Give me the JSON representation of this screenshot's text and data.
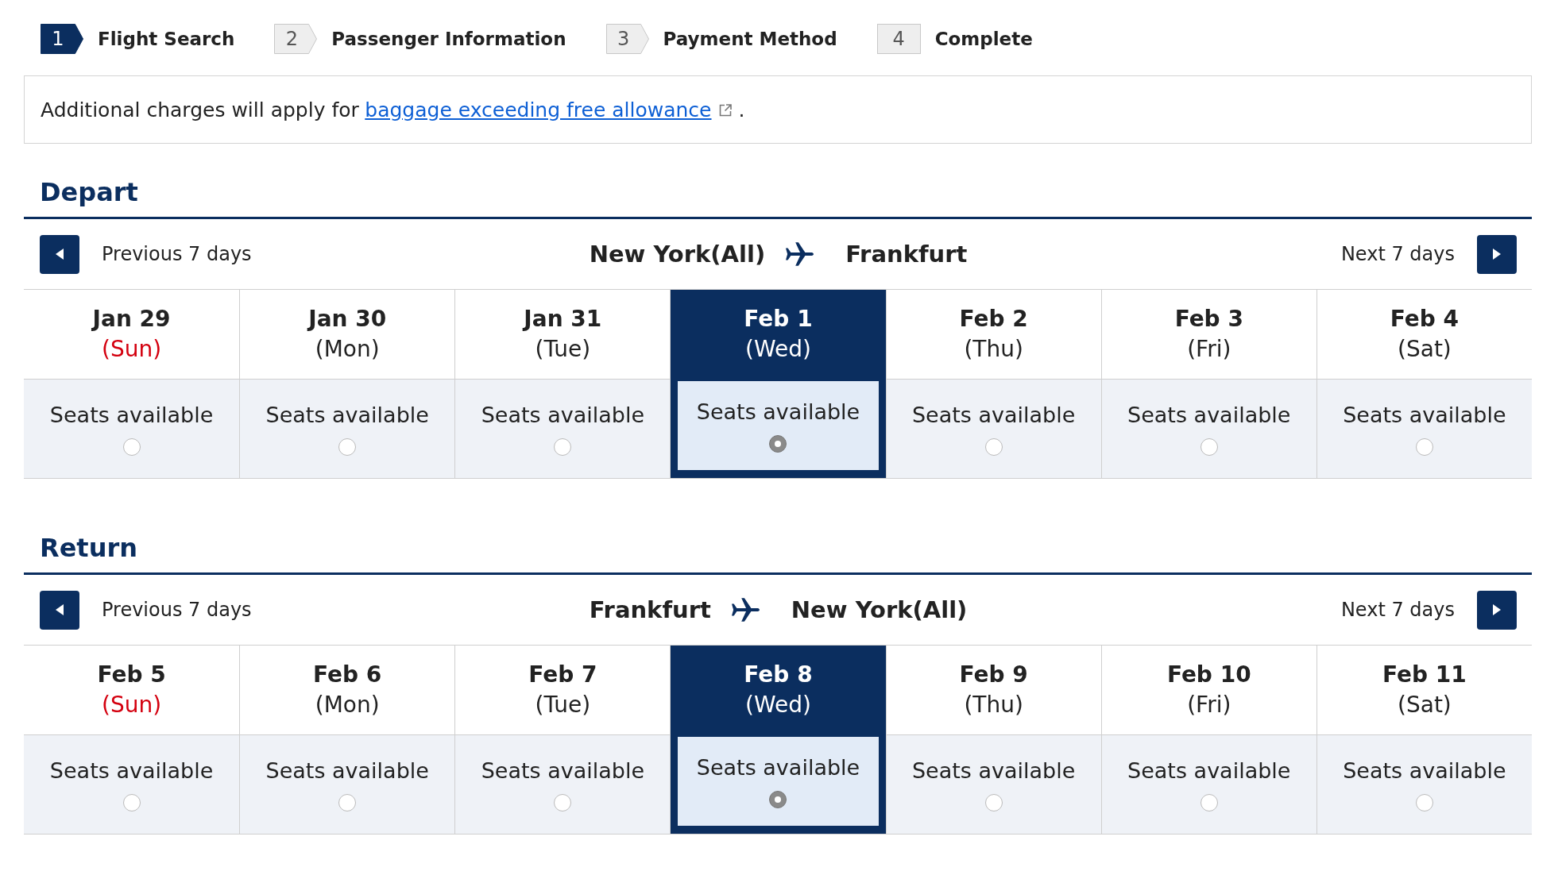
{
  "steps": [
    {
      "number": "1",
      "label": "Flight Search",
      "selected": true
    },
    {
      "number": "2",
      "label": "Passenger Information",
      "selected": false
    },
    {
      "number": "3",
      "label": "Payment Method",
      "selected": false
    },
    {
      "number": "4",
      "label": "Complete",
      "selected": false
    }
  ],
  "notice": {
    "text": "Additional charges will apply for",
    "link": "baggage exceeding free allowance",
    "suffix": "."
  },
  "legs": [
    {
      "title": "Depart",
      "previous_label": "Previous 7 days",
      "origin": "New York(All)",
      "destination": "Frankfurt",
      "next_label": "Next 7 days",
      "days": [
        {
          "date": "Jan 29",
          "weekday": "(Sun)",
          "holiday": true,
          "availability": "Seats available",
          "selected": false
        },
        {
          "date": "Jan 30",
          "weekday": "(Mon)",
          "holiday": false,
          "availability": "Seats available",
          "selected": false
        },
        {
          "date": "Jan 31",
          "weekday": "(Tue)",
          "holiday": false,
          "availability": "Seats available",
          "selected": false
        },
        {
          "date": "Feb 1",
          "weekday": "(Wed)",
          "holiday": false,
          "availability": "Seats available",
          "selected": true
        },
        {
          "date": "Feb 2",
          "weekday": "(Thu)",
          "holiday": false,
          "availability": "Seats available",
          "selected": false
        },
        {
          "date": "Feb 3",
          "weekday": "(Fri)",
          "holiday": false,
          "availability": "Seats available",
          "selected": false
        },
        {
          "date": "Feb 4",
          "weekday": "(Sat)",
          "holiday": false,
          "availability": "Seats available",
          "selected": false
        }
      ]
    },
    {
      "title": "Return",
      "previous_label": "Previous 7 days",
      "origin": "Frankfurt",
      "destination": "New York(All)",
      "next_label": "Next 7 days",
      "days": [
        {
          "date": "Feb 5",
          "weekday": "(Sun)",
          "holiday": true,
          "availability": "Seats available",
          "selected": false
        },
        {
          "date": "Feb 6",
          "weekday": "(Mon)",
          "holiday": false,
          "availability": "Seats available",
          "selected": false
        },
        {
          "date": "Feb 7",
          "weekday": "(Tue)",
          "holiday": false,
          "availability": "Seats available",
          "selected": false
        },
        {
          "date": "Feb 8",
          "weekday": "(Wed)",
          "holiday": false,
          "availability": "Seats available",
          "selected": true
        },
        {
          "date": "Feb 9",
          "weekday": "(Thu)",
          "holiday": false,
          "availability": "Seats available",
          "selected": false
        },
        {
          "date": "Feb 10",
          "weekday": "(Fri)",
          "holiday": false,
          "availability": "Seats available",
          "selected": false
        },
        {
          "date": "Feb 11",
          "weekday": "(Sat)",
          "holiday": false,
          "availability": "Seats available",
          "selected": false
        }
      ]
    }
  ]
}
